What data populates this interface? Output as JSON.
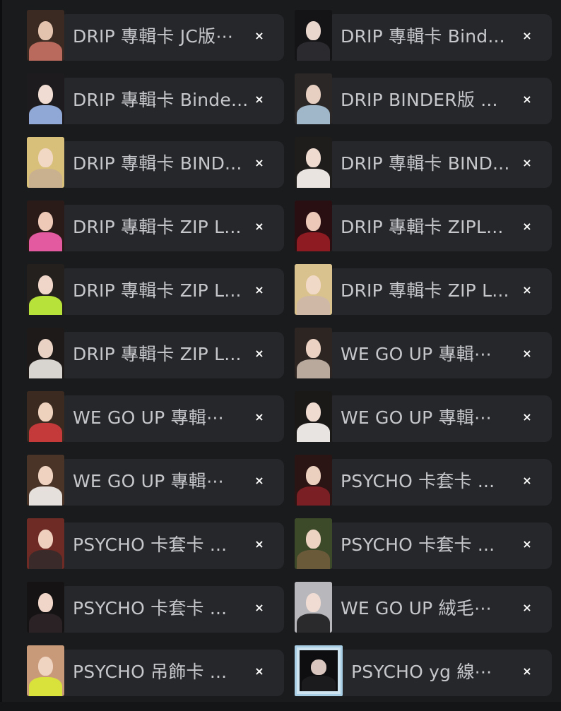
{
  "close_glyph": "×",
  "chips": [
    {
      "label": "DRIP 專輯卡 JC版⋯",
      "thumb": "photo",
      "colors": [
        "#3a2a22",
        "#e3c3ae",
        "#b96a5c"
      ]
    },
    {
      "label": "DRIP 專輯卡 Bind...",
      "thumb": "photo",
      "colors": [
        "#141416",
        "#e9d6cc",
        "#2b2a2f"
      ]
    },
    {
      "label": "DRIP 專輯卡 Binde...",
      "thumb": "photo",
      "colors": [
        "#1d1b1d",
        "#f0dcd2",
        "#8fa8d6"
      ]
    },
    {
      "label": "DRIP BINDER版 ...",
      "thumb": "photo",
      "colors": [
        "#2a2726",
        "#e7cfc2",
        "#9fb7c9"
      ]
    },
    {
      "label": "DRIP 專輯卡 BIND...",
      "thumb": "photo",
      "colors": [
        "#d8c07a",
        "#f0d8c4",
        "#c9b08f"
      ]
    },
    {
      "label": "DRIP 專輯卡 BIND...",
      "thumb": "photo",
      "colors": [
        "#1f1c1c",
        "#efdbd0",
        "#e9e4e0"
      ]
    },
    {
      "label": "DRIP 專輯卡 ZIP L...",
      "thumb": "photo",
      "colors": [
        "#2a1a18",
        "#eec9b8",
        "#e45aa0"
      ]
    },
    {
      "label": "DRIP 專輯卡 ZIPL...",
      "thumb": "photo",
      "colors": [
        "#2a0f12",
        "#ecc8b8",
        "#8e1a22"
      ]
    },
    {
      "label": "DRIP 專輯卡 ZIP L...",
      "thumb": "photo",
      "colors": [
        "#23201d",
        "#efd6c8",
        "#b7e23a"
      ]
    },
    {
      "label": "DRIP 專輯卡 ZIP L...",
      "thumb": "photo",
      "colors": [
        "#d9c28d",
        "#f1d9c8",
        "#cfb9a6"
      ]
    },
    {
      "label": "DRIP 專輯卡 ZIP L...",
      "thumb": "photo",
      "colors": [
        "#1e1a19",
        "#e9d2c4",
        "#d8d4cf"
      ]
    },
    {
      "label": "WE GO UP 專輯⋯",
      "thumb": "photo",
      "colors": [
        "#2c2522",
        "#ecd2c2",
        "#b9a89c"
      ]
    },
    {
      "label": "WE GO UP 專輯⋯",
      "thumb": "photo",
      "colors": [
        "#3b2a20",
        "#efd2bd",
        "#c43a3a"
      ]
    },
    {
      "label": "WE GO UP 專輯⋯",
      "thumb": "photo",
      "colors": [
        "#1b1818",
        "#f0dbd0",
        "#e8e4e2"
      ]
    },
    {
      "label": "WE GO UP 專輯⋯",
      "thumb": "photo",
      "colors": [
        "#4a3428",
        "#efd3c0",
        "#e5e0db"
      ]
    },
    {
      "label": "PSYCHO 卡套卡 ...",
      "thumb": "photo",
      "colors": [
        "#2a1414",
        "#ecd0bf",
        "#7a1f24"
      ]
    },
    {
      "label": "PSYCHO 卡套卡 ...",
      "thumb": "photo",
      "colors": [
        "#6e2a24",
        "#efcfbd",
        "#3a2a2a"
      ]
    },
    {
      "label": "PSYCHO 卡套卡 ...",
      "thumb": "photo",
      "colors": [
        "#3d4a2a",
        "#ecd3c2",
        "#6b5a3a"
      ]
    },
    {
      "label": "PSYCHO 卡套卡 ...",
      "thumb": "photo",
      "colors": [
        "#161314",
        "#efd6c9",
        "#2a2224"
      ]
    },
    {
      "label": "WE GO UP 絨毛⋯",
      "thumb": "photo",
      "colors": [
        "#b8b8bc",
        "#f0dcd3",
        "#2a2a2c"
      ]
    },
    {
      "label": "PSYCHO 吊飾卡 ...",
      "thumb": "photo",
      "colors": [
        "#c89a7a",
        "#f0d4c2",
        "#d9e23a"
      ]
    },
    {
      "label": "PSYCHO yg 線⋯",
      "thumb": "framed",
      "colors": [
        "#0e0e10",
        "#d9c6bf",
        "#1b1b1e"
      ]
    }
  ]
}
